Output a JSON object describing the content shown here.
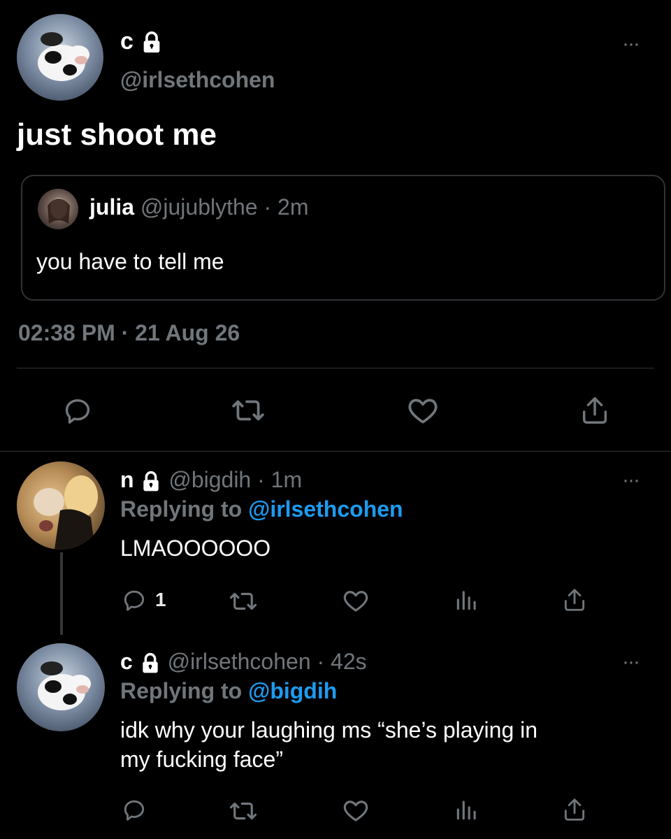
{
  "main_tweet": {
    "display_name": "c",
    "handle": "@irlsethcohen",
    "text": "just shoot me",
    "timestamp": "02:38 PM · 21 Aug 26",
    "more_label": "···"
  },
  "quoted_tweet": {
    "display_name": "julia",
    "handle": "@jujublythe",
    "time": "· 2m",
    "text": "you have to tell me"
  },
  "reply_1": {
    "display_name": "n",
    "handle": "@bigdih",
    "time": "· 1m",
    "replying_prefix": "Replying to",
    "replying_to": "@irlsethcohen",
    "text": "LMAOOOOOO",
    "reply_count": "1",
    "more_label": "···"
  },
  "reply_2": {
    "display_name": "c",
    "handle": "@irlsethcohen",
    "time": "· 42s",
    "replying_prefix": "Replying to",
    "replying_to": "@bigdih",
    "text_line1": "idk why your laughing ms “she’s playing in",
    "text_line2": "my fucking face”",
    "more_label": "···"
  },
  "colors": {
    "background": "#000000",
    "muted": "#71767b",
    "link_blue": "#1d9bf0",
    "divider": "#2f3336"
  },
  "icons": [
    "lock-icon",
    "more-icon",
    "reply-icon",
    "retweet-icon",
    "like-icon",
    "share-icon",
    "analytics-icon"
  ]
}
